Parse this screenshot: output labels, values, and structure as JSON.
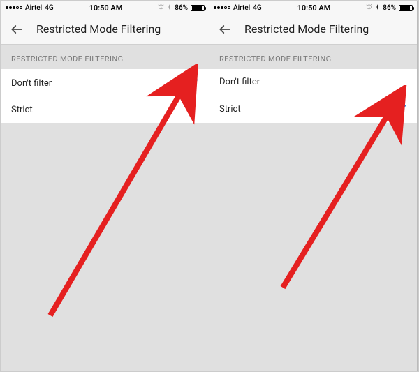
{
  "status_bar": {
    "carrier": "Airtel",
    "network": "4G",
    "time": "10:50 AM",
    "battery_percent": "86%"
  },
  "header": {
    "title": "Restricted Mode Filtering"
  },
  "section": {
    "label": "RESTRICTED MODE FILTERING"
  },
  "options": {
    "dont_filter": "Don't filter",
    "strict": "Strict"
  },
  "screens": {
    "left_selected": "dont_filter",
    "right_selected": "strict"
  }
}
